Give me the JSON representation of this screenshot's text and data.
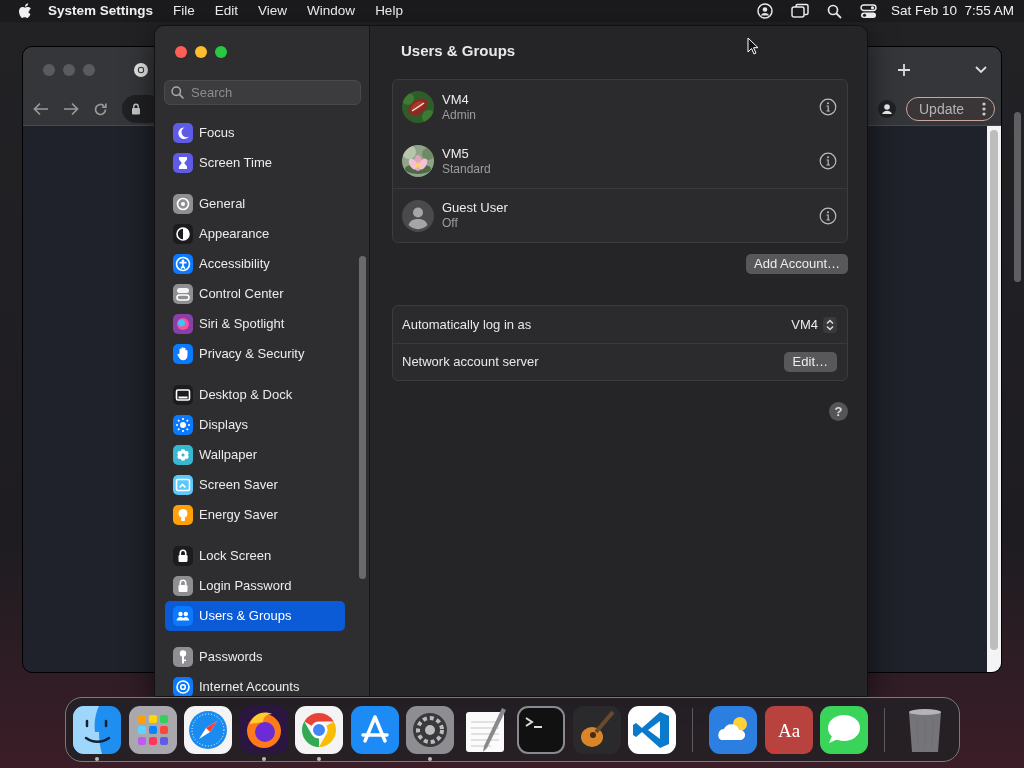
{
  "menu_bar": {
    "app_name": "System Settings",
    "menus": [
      "File",
      "Edit",
      "View",
      "Window",
      "Help"
    ],
    "clock": "Sat Feb 10  7:55 AM"
  },
  "browser": {
    "update_button": "Update"
  },
  "settings_window": {
    "search": {
      "placeholder": "Search"
    },
    "sidebar": {
      "groups": [
        {
          "items": [
            {
              "label": "Focus",
              "kind": "moon",
              "color": "#5e5ce6",
              "selected": false
            },
            {
              "label": "Screen Time",
              "kind": "hourglass",
              "color": "#5e5ce6",
              "selected": false
            }
          ]
        },
        {
          "items": [
            {
              "label": "General",
              "kind": "gear",
              "color": "#8e8e93",
              "selected": false
            },
            {
              "label": "Appearance",
              "kind": "contrast",
              "color": "#1c1c1e",
              "selected": false
            },
            {
              "label": "Accessibility",
              "kind": "person",
              "color": "#0a7aff",
              "selected": false
            },
            {
              "label": "Control Center",
              "kind": "toggles",
              "color": "#8e8e93",
              "selected": false
            },
            {
              "label": "Siri & Spotlight",
              "kind": "orb",
              "color": "#8a3fa8",
              "selected": false
            },
            {
              "label": "Privacy & Security",
              "kind": "hand",
              "color": "#0a7aff",
              "selected": false
            }
          ]
        },
        {
          "items": [
            {
              "label": "Desktop & Dock",
              "kind": "dock",
              "color": "#1c1c1e",
              "selected": false
            },
            {
              "label": "Displays",
              "kind": "sun",
              "color": "#0a7aff",
              "selected": false
            },
            {
              "label": "Wallpaper",
              "kind": "flower",
              "color": "#38b8d0",
              "selected": false
            },
            {
              "label": "Screen Saver",
              "kind": "screen",
              "color": "#5ac8fa",
              "selected": false
            },
            {
              "label": "Energy Saver",
              "kind": "bulb",
              "color": "#ff9f0a",
              "selected": false
            }
          ]
        },
        {
          "items": [
            {
              "label": "Lock Screen",
              "kind": "lock",
              "color": "#1c1c1e",
              "selected": false
            },
            {
              "label": "Login Password",
              "kind": "lock",
              "color": "#8e8e93",
              "selected": false
            },
            {
              "label": "Users & Groups",
              "kind": "people",
              "color": "#0a7aff",
              "selected": true
            }
          ]
        },
        {
          "items": [
            {
              "label": "Passwords",
              "kind": "key",
              "color": "#8e8e93",
              "selected": false
            },
            {
              "label": "Internet Accounts",
              "kind": "at",
              "color": "#0a7aff",
              "selected": false
            }
          ]
        }
      ]
    },
    "page_title": "Users & Groups",
    "users": [
      {
        "name": "VM4",
        "role": "Admin",
        "kind": "picture"
      },
      {
        "name": "VM5",
        "role": "Standard",
        "kind": "picture"
      },
      {
        "name": "Guest User",
        "role": "Off",
        "kind": "silhouette"
      }
    ],
    "add_account_button": "Add Account…",
    "options": [
      {
        "kind": "popup",
        "label": "Automatically log in as",
        "value": "VM4"
      },
      {
        "kind": "button",
        "label": "Network account server",
        "button": "Edit…"
      }
    ],
    "help_button": "?"
  },
  "dock": {
    "sections": [
      {
        "items": [
          {
            "kind": "finder",
            "running": true
          },
          {
            "kind": "launchpad",
            "running": false
          },
          {
            "kind": "safari",
            "running": false
          },
          {
            "kind": "firefox",
            "running": true
          },
          {
            "kind": "chrome",
            "running": true
          },
          {
            "kind": "appstore",
            "running": false
          },
          {
            "kind": "settings",
            "running": true
          },
          {
            "kind": "textedit",
            "running": false
          },
          {
            "kind": "terminal",
            "running": false
          },
          {
            "kind": "garageband",
            "running": false
          },
          {
            "kind": "vscode",
            "running": false
          }
        ]
      },
      {
        "items": [
          {
            "kind": "weather",
            "running": false
          },
          {
            "kind": "dictionary",
            "label": "Aa",
            "running": false
          },
          {
            "kind": "messages",
            "running": false
          }
        ]
      },
      {
        "items": [
          {
            "kind": "trash",
            "running": false
          }
        ]
      }
    ]
  }
}
